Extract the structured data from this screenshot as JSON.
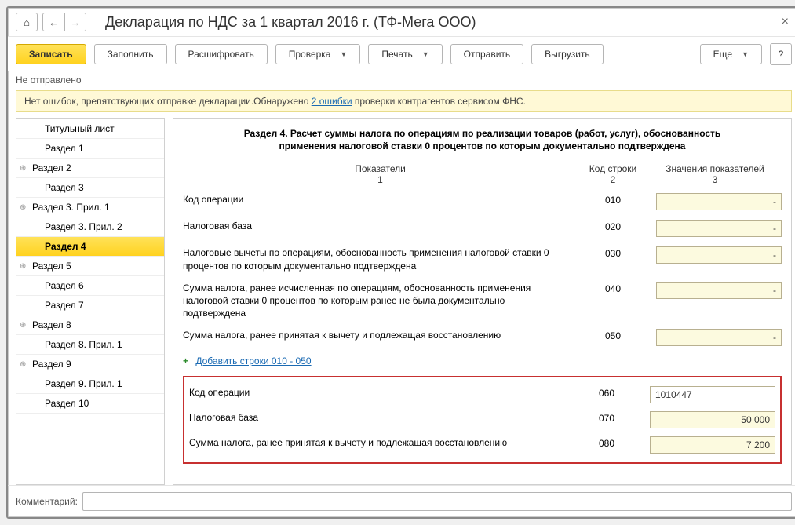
{
  "title": "Декларация по НДС за 1 квартал 2016 г. (ТФ-Мега ООО)",
  "toolbar": {
    "save": "Записать",
    "fill": "Заполнить",
    "decode": "Расшифровать",
    "check": "Проверка",
    "print": "Печать",
    "send": "Отправить",
    "export": "Выгрузить",
    "more": "Еще"
  },
  "status": "Не отправлено",
  "alert": {
    "pre": "Нет ошибок, препятствующих отправке декларации.Обнаружено ",
    "link": "2 ошибки",
    "post": " проверки контрагентов сервисом ФНС."
  },
  "sidebar": [
    {
      "label": "Титульный лист",
      "exp": false,
      "indent": true
    },
    {
      "label": "Раздел 1",
      "exp": false,
      "indent": true
    },
    {
      "label": "Раздел 2",
      "exp": true
    },
    {
      "label": "Раздел 3",
      "exp": false,
      "indent": true
    },
    {
      "label": "Раздел 3. Прил. 1",
      "exp": true
    },
    {
      "label": "Раздел 3. Прил. 2",
      "exp": false,
      "indent": true
    },
    {
      "label": "Раздел 4",
      "exp": false,
      "indent": true,
      "active": true
    },
    {
      "label": "Раздел 5",
      "exp": true
    },
    {
      "label": "Раздел 6",
      "exp": false,
      "indent": true
    },
    {
      "label": "Раздел 7",
      "exp": false,
      "indent": true
    },
    {
      "label": "Раздел 8",
      "exp": true
    },
    {
      "label": "Раздел 8. Прил. 1",
      "exp": false,
      "indent": true
    },
    {
      "label": "Раздел 9",
      "exp": true
    },
    {
      "label": "Раздел 9. Прил. 1",
      "exp": false,
      "indent": true
    },
    {
      "label": "Раздел 10",
      "exp": false,
      "indent": true
    }
  ],
  "section": {
    "title": "Раздел 4. Расчет суммы налога по операциям по реализации товаров (работ, услуг), обоснованность применения налоговой ставки 0 процентов по которым документально подтверждена",
    "cols": {
      "c1a": "Показатели",
      "c1b": "1",
      "c2a": "Код строки",
      "c2b": "2",
      "c3a": "Значения показателей",
      "c3b": "3"
    },
    "rows": [
      {
        "label": "Код операции",
        "code": "010",
        "val": "-"
      },
      {
        "label": "Налоговая база",
        "code": "020",
        "val": "-"
      },
      {
        "label": "Налоговые вычеты по операциям, обоснованность применения налоговой ставки 0 процентов по которым документально подтверждена",
        "code": "030",
        "val": "-"
      },
      {
        "label": "Сумма налога, ранее исчисленная по операциям, обоснованность применения налоговой ставки 0 процентов по которым ранее не была документально подтверждена",
        "code": "040",
        "val": "-"
      },
      {
        "label": "Сумма налога, ранее принятая к вычету и подлежащая восстановлению",
        "code": "050",
        "val": "-"
      }
    ],
    "addlink": "Добавить строки 010 - 050",
    "redrows": [
      {
        "label": "Код операции",
        "code": "060",
        "val": "1010447",
        "white": true
      },
      {
        "label": "Налоговая база",
        "code": "070",
        "val": "50 000"
      },
      {
        "label": "Сумма налога, ранее принятая к вычету и подлежащая восстановлению",
        "code": "080",
        "val": "7 200"
      }
    ]
  },
  "footer": {
    "label": "Комментарий:",
    "value": ""
  }
}
